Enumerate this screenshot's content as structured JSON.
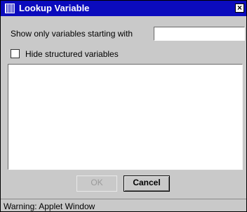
{
  "window": {
    "title": "Lookup Variable",
    "close_glyph": "×"
  },
  "filter": {
    "label": "Show only variables starting with",
    "value": ""
  },
  "hide_structured": {
    "label": "Hide structured variables",
    "checked": false
  },
  "variable_list": {
    "items": []
  },
  "buttons": {
    "ok_label": "OK",
    "ok_enabled": false,
    "cancel_label": "Cancel"
  },
  "status_bar": {
    "text": "Warning: Applet Window"
  },
  "colors": {
    "titlebar": "#0b0bbd",
    "dialog_bg": "#c9c9c9",
    "field_bg": "#ffffff"
  },
  "icons": {
    "window_icon": "applet-window-icon",
    "close_icon": "close-icon"
  }
}
